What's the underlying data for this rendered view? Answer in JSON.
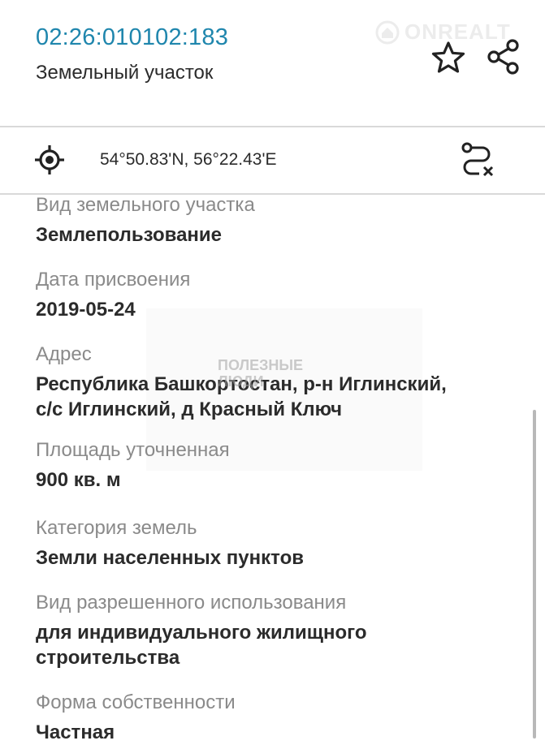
{
  "header": {
    "cadastral_number": "02:26:010102:183",
    "object_type": "Земельный участок",
    "watermark_text": "ONREALT"
  },
  "coords_bar": {
    "coordinates": "54°50.83'N, 56°22.43'E"
  },
  "details": {
    "fields": [
      {
        "label": "Вид земельного участка",
        "value": "Землепользование"
      },
      {
        "label": "Дата присвоения",
        "value": "2019-05-24"
      },
      {
        "label": "Адрес",
        "value_line1": "Республика Башкортостан, р-н Иглинский,",
        "value_line2": "с/с Иглинский, д Красный Ключ"
      },
      {
        "label": "Площадь уточненная",
        "value": "900 кв. м"
      },
      {
        "label": "Категория земель",
        "value": "Земли населенных пунктов"
      },
      {
        "label": "Вид разрешенного использования",
        "value_line1": "для индивидуального жилищного",
        "value_line2": "строительства"
      },
      {
        "label": "Форма собственности",
        "value": "Частная"
      }
    ]
  },
  "stamp": {
    "line1": "ПОЛЕЗНЫЕ",
    "line2": "ЛЮДИ"
  },
  "colors": {
    "accent": "#1f86ad",
    "label_gray": "#8a8a8a",
    "text": "#2b2b2b",
    "divider": "#d9d9d9"
  },
  "icons": {
    "watermark": "house-logo-icon",
    "favorite": "star-outline-icon",
    "share": "share-icon",
    "locate": "crosshair-target-icon",
    "route": "route-clear-icon"
  }
}
